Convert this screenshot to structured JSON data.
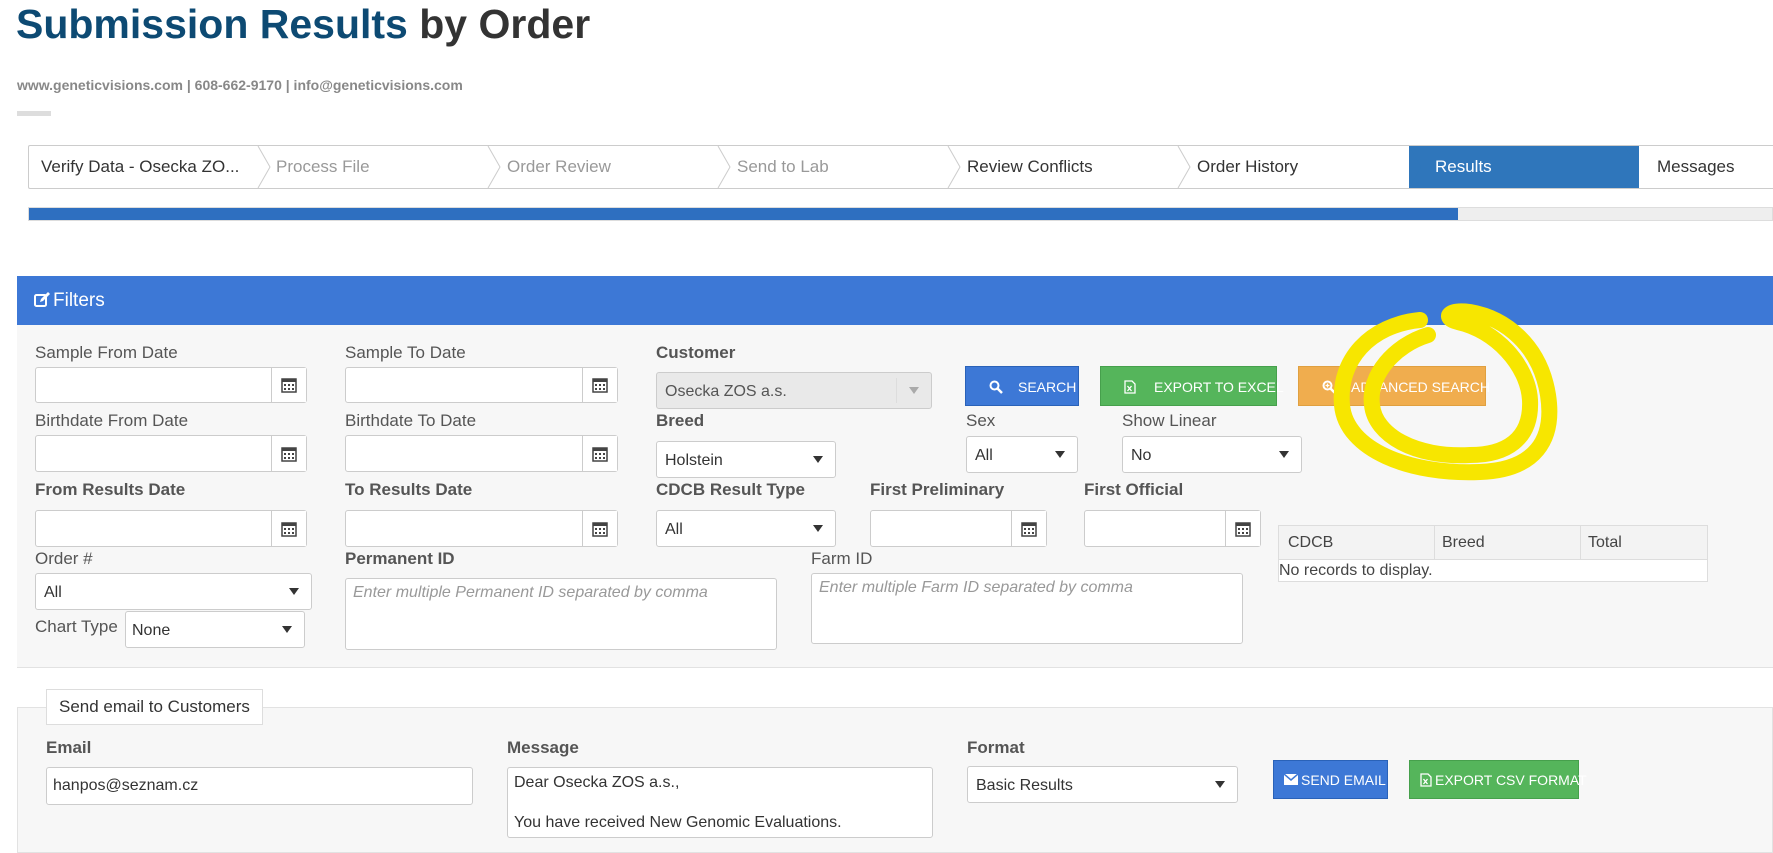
{
  "header": {
    "title_part1": "Submission Results",
    "title_part2": " by Order",
    "contact": "www.geneticvisions.com | 608-662-9170 | info@geneticvisions.com"
  },
  "wizard": {
    "steps": [
      {
        "label": "Verify Data - Osecka ZO...",
        "state": "normal"
      },
      {
        "label": "Process File",
        "state": "disabled"
      },
      {
        "label": "Order Review",
        "state": "disabled"
      },
      {
        "label": "Send to Lab",
        "state": "disabled"
      },
      {
        "label": "Review Conflicts",
        "state": "normal"
      },
      {
        "label": "Order History",
        "state": "normal"
      },
      {
        "label": "Results",
        "state": "active"
      },
      {
        "label": "Messages",
        "state": "normal"
      }
    ],
    "progress_fraction": 0.82
  },
  "filters": {
    "title": "Filters",
    "sample_from_date": {
      "label": "Sample From Date",
      "value": ""
    },
    "sample_to_date": {
      "label": "Sample To Date",
      "value": ""
    },
    "customer": {
      "label": "Customer",
      "value": "Osecka ZOS a.s."
    },
    "birthdate_from": {
      "label": "Birthdate From Date",
      "value": ""
    },
    "birthdate_to": {
      "label": "Birthdate To Date",
      "value": ""
    },
    "breed": {
      "label": "Breed",
      "value": "Holstein"
    },
    "sex": {
      "label": "Sex",
      "value": "All"
    },
    "show_linear": {
      "label": "Show Linear",
      "value": "No"
    },
    "from_results_date": {
      "label": "From Results Date",
      "value": ""
    },
    "to_results_date": {
      "label": "To Results Date",
      "value": ""
    },
    "cdcb_result_type": {
      "label": "CDCB Result Type",
      "value": "All"
    },
    "first_preliminary": {
      "label": "First Preliminary",
      "value": ""
    },
    "first_official": {
      "label": "First Official",
      "value": ""
    },
    "order_number": {
      "label": "Order #",
      "value": "All"
    },
    "chart_type": {
      "label": "Chart Type",
      "value": "None"
    },
    "permanent_id": {
      "label": "Permanent ID",
      "placeholder": "Enter multiple Permanent ID separated by comma"
    },
    "farm_id": {
      "label": "Farm ID",
      "placeholder": "Enter multiple Farm ID separated by comma"
    },
    "buttons": {
      "search": "SEARCH",
      "export_excel": "EXPORT TO EXCEL",
      "advanced_search": "ADVANCED SEARCH"
    },
    "summary_grid": {
      "columns": [
        "CDCB",
        "Breed",
        "Total"
      ],
      "empty_text": "No records to display."
    }
  },
  "email": {
    "legend": "Send email to Customers",
    "email_label": "Email",
    "email_value": "hanpos@seznam.cz",
    "message_label": "Message",
    "message_value": "Dear Osecka ZOS a.s.,\n\nYou have received New Genomic Evaluations.",
    "format_label": "Format",
    "format_value": "Basic Results",
    "send_button": "SEND EMAIL",
    "export_csv_button": "EXPORT CSV FORMAT"
  },
  "colors": {
    "title_blue": "#0d4a73",
    "panel_blue": "#3d78d6",
    "active_step": "#2f76bb",
    "success_green": "#55b55b",
    "warning_orange": "#f0ad4e",
    "annotation_yellow": "#f7e600"
  }
}
